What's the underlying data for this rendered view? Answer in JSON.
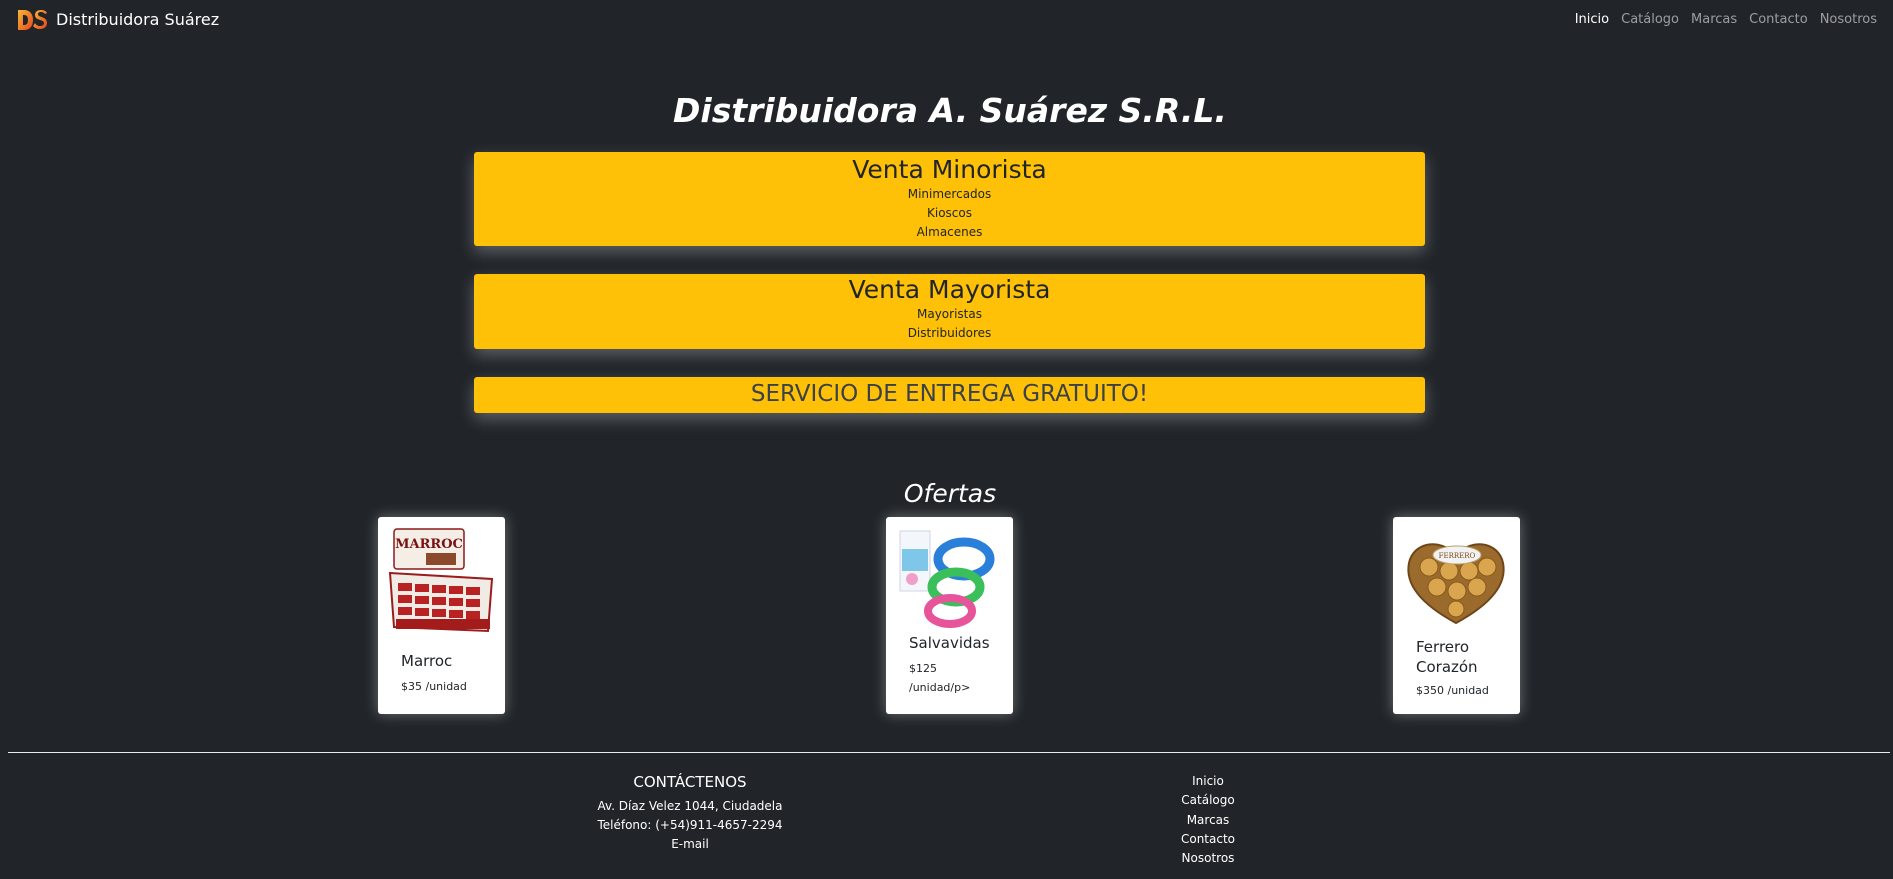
{
  "navbar": {
    "brand": "Distribuidora Suárez",
    "logo_text": "DS",
    "links": [
      "Inicio",
      "Catálogo",
      "Marcas",
      "Contacto",
      "Nosotros"
    ],
    "active_link": "Inicio"
  },
  "hero": {
    "title": "Distribuidora A. Suárez S.R.L."
  },
  "services": {
    "minorista": {
      "title": "Venta Minorista",
      "items": [
        "Minimercados",
        "Kioscos",
        "Almacenes"
      ]
    },
    "mayorista": {
      "title": "Venta Mayorista",
      "items": [
        "Mayoristas",
        "Distribuidores"
      ]
    },
    "entrega": {
      "title": "SERVICIO DE ENTREGA GRATUITO!"
    }
  },
  "ofertas": {
    "title": "Ofertas",
    "cards": [
      {
        "name": "Marroc",
        "price": "$35 /unidad",
        "image": "marroc-box-image"
      },
      {
        "name": "Salvavidas",
        "price": "$125 /unidad/p>",
        "image": "swim-rings-image"
      },
      {
        "name": "Ferrero Corazón",
        "price": "$350 /unidad",
        "image": "ferrero-heart-image"
      }
    ]
  },
  "footer": {
    "contact_title": "CONTÁCTENOS",
    "address": "Av. Díaz Velez 1044, Ciudadela",
    "phone": "Teléfono: (+54)911-4657-2294",
    "email": "E-mail",
    "links": [
      "Inicio",
      "Catálogo",
      "Marcas",
      "Contacto",
      "Nosotros"
    ]
  },
  "colors": {
    "background": "#212529",
    "accent": "#ffc107",
    "text": "#ffffff"
  }
}
